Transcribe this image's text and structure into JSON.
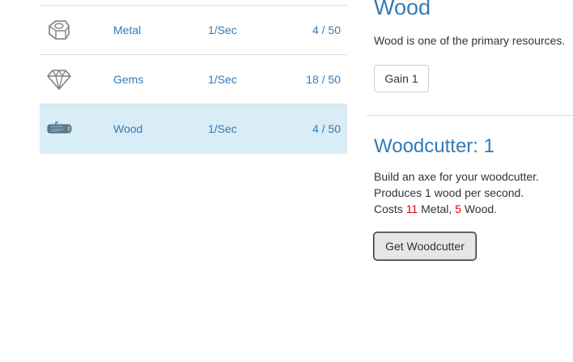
{
  "resources": [
    {
      "name": "Metal",
      "rate": "1/Sec",
      "amount": "4 / 50",
      "icon": "metal-nut-icon",
      "active": false
    },
    {
      "name": "Gems",
      "rate": "1/Sec",
      "amount": "18 / 50",
      "icon": "gem-icon",
      "active": false
    },
    {
      "name": "Wood",
      "rate": "1/Sec",
      "amount": "4 / 50",
      "icon": "wood-log-icon",
      "active": true
    }
  ],
  "selected_resource": {
    "title": "Wood",
    "description": "Wood is one of the primary resources.",
    "gain_label": "Gain 1"
  },
  "building": {
    "title": "Woodcutter: 1",
    "line1": "Build an axe for your woodcutter.",
    "line2": "Produces 1 wood per second.",
    "cost_prefix": "Costs ",
    "cost_metal_amount": "11",
    "cost_metal_label": " Metal, ",
    "cost_wood_amount": "5",
    "cost_wood_label": " Wood.",
    "button_label": "Get Woodcutter"
  },
  "colors": {
    "link": "#337ab7",
    "active_row": "#d9edf7",
    "cost_highlight": "#dd0000"
  }
}
